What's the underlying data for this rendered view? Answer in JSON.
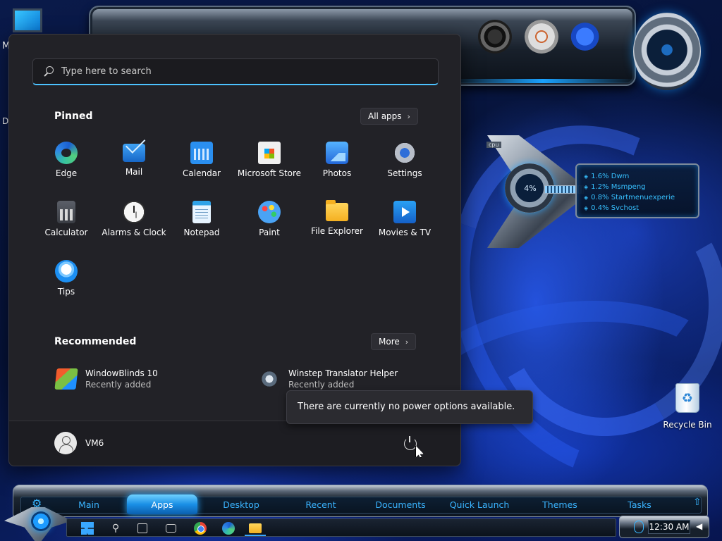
{
  "desktop": {
    "icon_fragment_top": "M",
    "icon_fragment_mid": "Di",
    "recycle_bin": "Recycle Bin"
  },
  "cpu_gadget": {
    "tag": "cpu",
    "percent": "4%",
    "processes": [
      "1.6% Dwm",
      "1.2% Msmpeng",
      "0.8% Startmenuexperie",
      "0.4% Svchost"
    ]
  },
  "start_menu": {
    "search_placeholder": "Type here to search",
    "pinned_title": "Pinned",
    "all_apps_label": "All apps",
    "pinned_apps": [
      {
        "label": "Edge",
        "icon": "edge-icon"
      },
      {
        "label": "Mail",
        "icon": "mail-icon"
      },
      {
        "label": "Calendar",
        "icon": "calendar-icon"
      },
      {
        "label": "Microsoft Store",
        "icon": "store-icon"
      },
      {
        "label": "Photos",
        "icon": "photos-icon"
      },
      {
        "label": "Settings",
        "icon": "settings-icon"
      },
      {
        "label": "Calculator",
        "icon": "calculator-icon"
      },
      {
        "label": "Alarms & Clock",
        "icon": "clock-icon"
      },
      {
        "label": "Notepad",
        "icon": "notepad-icon"
      },
      {
        "label": "Paint",
        "icon": "paint-icon"
      },
      {
        "label": "File Explorer",
        "icon": "folder-icon"
      },
      {
        "label": "Movies & TV",
        "icon": "movies-icon"
      },
      {
        "label": "Tips",
        "icon": "lightbulb-icon"
      }
    ],
    "recommended_title": "Recommended",
    "more_label": "More",
    "recommended": [
      {
        "name": "WindowBlinds 10",
        "sub": "Recently added"
      },
      {
        "name": "Winstep Translator Helper",
        "sub": "Recently added"
      }
    ],
    "user_name": "VM6",
    "power_tooltip": "There are currently no power options available."
  },
  "bottom_bar": {
    "tabs": [
      "Main",
      "Apps",
      "Desktop",
      "Recent",
      "Documents",
      "Quick Launch",
      "Themes",
      "Tasks"
    ],
    "active_tab": "Apps"
  },
  "taskbar": {
    "clock": "12:30 AM"
  }
}
